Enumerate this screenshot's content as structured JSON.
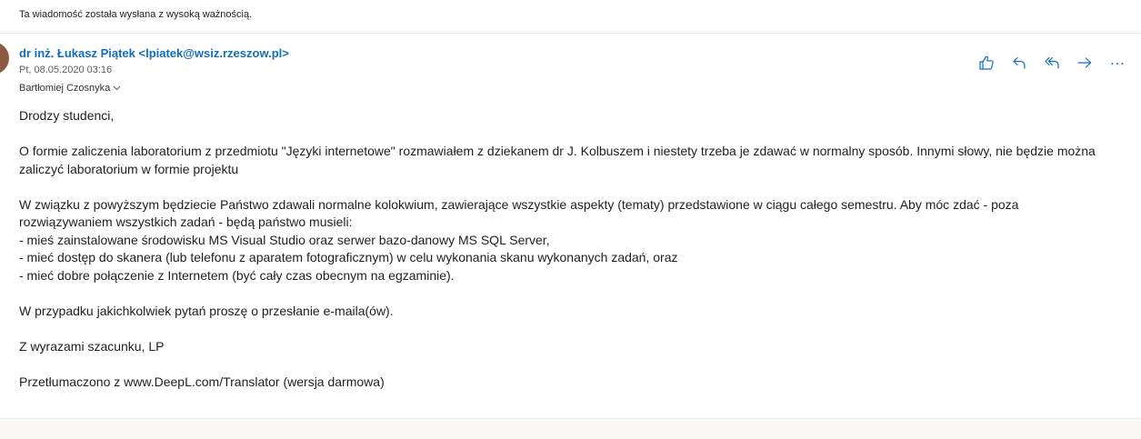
{
  "importance_notice": "Ta wiadomość została wysłana z wysoką ważnością.",
  "message": {
    "sender": "dr inż. Łukasz Piątek <lpiatek@wsiz.rzeszow.pl>",
    "date": "Pt, 08.05.2020 03:16",
    "recipient": "Bartłomiej Czosnyka"
  },
  "actions": [
    {
      "name": "like-icon"
    },
    {
      "name": "reply-icon"
    },
    {
      "name": "reply-all-icon"
    },
    {
      "name": "forward-icon"
    },
    {
      "name": "more-icon"
    }
  ],
  "body": {
    "paragraphs": [
      "Drodzy studenci,",
      "O formie zaliczenia laboratorium z przedmiotu \"Języki internetowe\" rozmawiałem z dziekanem dr J. Kolbuszem i niestety trzeba je zdawać w normalny sposób. Innymi słowy, nie będzie można zaliczyć laboratorium w formie projektu",
      "W związku z powyższym będziecie Państwo zdawali normalne kolokwium, zawierające wszystkie aspekty (tematy) przedstawione w ciągu całego semestru. Aby móc zdać - poza rozwiązywaniem wszystkich zadań - będą państwo musieli:\n- mieś zainstalowane środowisku MS Visual Studio oraz serwer bazo-danowy MS SQL Server,\n- mieć dostęp do skanera (lub telefonu z aparatem fotograficznym) w celu wykonania skanu wykonanych zadań, oraz\n- mieć dobre połączenie z Internetem (być cały czas obecnym na egzaminie).",
      "W przypadku jakichkolwiek pytań proszę o przesłanie e-maila(ów).",
      "Z wyrazami szacunku, LP",
      "Przetłumaczono z www.DeepL.com/Translator (wersja darmowa)"
    ]
  },
  "colors": {
    "accent": "#106ebe",
    "text": "#201f1e",
    "secondary_text": "#605e5c",
    "footer_bg": "#faf9f8"
  }
}
